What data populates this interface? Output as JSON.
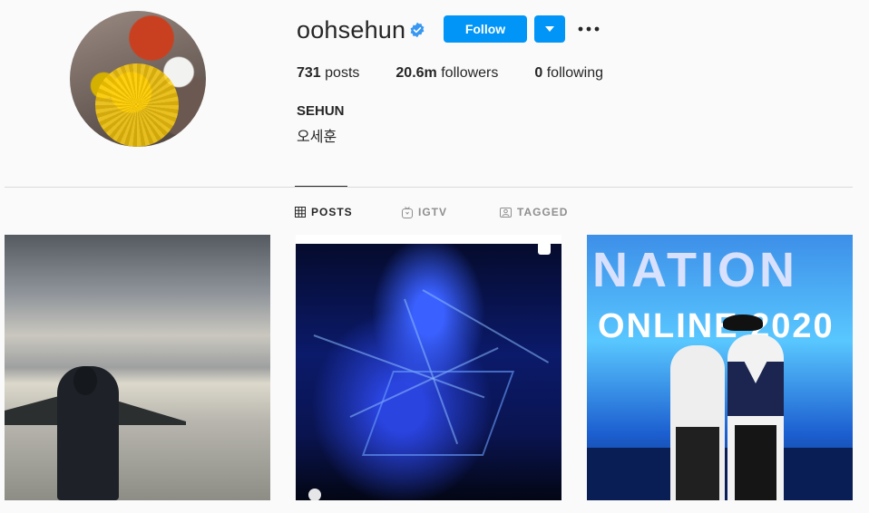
{
  "profile": {
    "username": "oohsehun",
    "verified": true,
    "follow_label": "Follow",
    "stats": {
      "posts_count": "731",
      "posts_label": "posts",
      "followers_count": "20.6m",
      "followers_label": "followers",
      "following_count": "0",
      "following_label": "following"
    },
    "full_name": "SEHUN",
    "bio": "오세훈"
  },
  "tabs": [
    {
      "label": "POSTS",
      "icon": "grid-icon",
      "active": true
    },
    {
      "label": "IGTV",
      "icon": "igtv-icon",
      "active": false
    },
    {
      "label": "TAGGED",
      "icon": "tagged-icon",
      "active": false
    }
  ],
  "posts": [
    {
      "kind": "image",
      "description_icon": "photo"
    },
    {
      "kind": "reel",
      "description_icon": "reel-icon"
    },
    {
      "kind": "image",
      "description_icon": "photo"
    }
  ],
  "post3_text": {
    "top": "NATION",
    "middle": "ONLINE 2020"
  },
  "colors": {
    "accent": "#0095f6",
    "text": "#262626",
    "muted": "#8e8e8e",
    "background": "#fafafa",
    "verified": "#3897f0"
  }
}
